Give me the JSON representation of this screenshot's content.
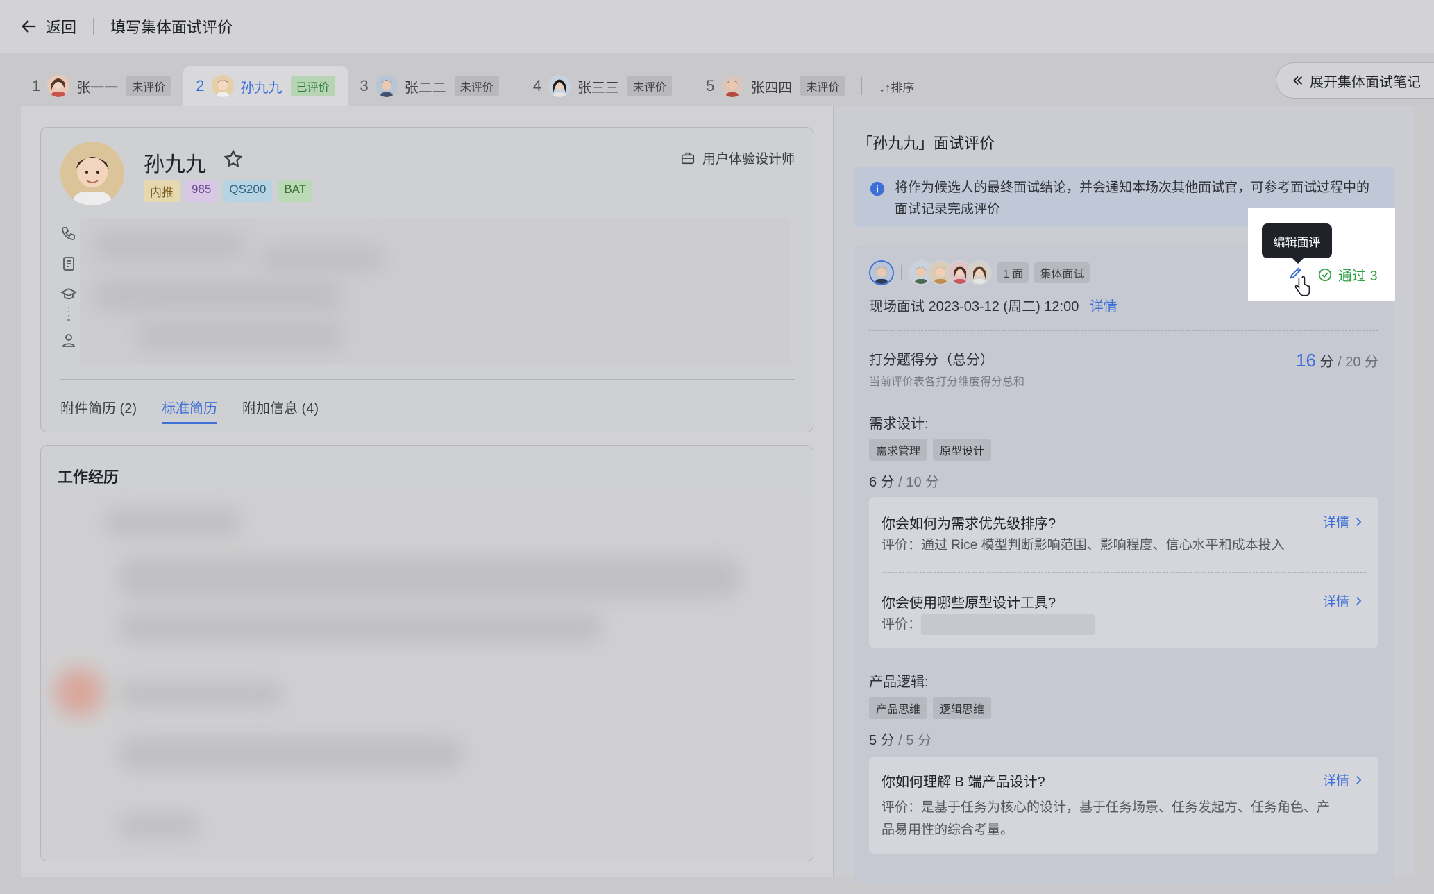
{
  "header": {
    "back_label": "返回",
    "title": "填写集体面试评价"
  },
  "candidates": [
    {
      "index": "1",
      "name": "张一一",
      "status": "未评价"
    },
    {
      "index": "2",
      "name": "孙九九",
      "status": "已评价"
    },
    {
      "index": "3",
      "name": "张二二",
      "status": "未评价"
    },
    {
      "index": "4",
      "name": "张三三",
      "status": "未评价"
    },
    {
      "index": "5",
      "name": "张四四",
      "status": "未评价"
    }
  ],
  "sort_label": "↓↑排序",
  "notes_button": "展开集体面试笔记",
  "profile": {
    "name": "孙九九",
    "tags": [
      "内推",
      "985",
      "QS200",
      "BAT"
    ],
    "job": "用户体验设计师",
    "subtabs": [
      "附件简历 (2)",
      "标准简历",
      "附加信息 (4)"
    ],
    "work_title": "工作经历"
  },
  "evaluation": {
    "title": "「孙九九」面试评价",
    "notice": "将作为候选人的最终面试结论，并会通知本场次其他面试官，可参考面试过程中的面试记录完成评价",
    "tooltip": "编辑面评",
    "result": "通过 3",
    "round": "1 面",
    "type": "集体面试",
    "meeting": "现场面试 2023-03-12 (周二) 12:00",
    "meeting_detail": "详情",
    "score_label": "打分题得分（总分）",
    "score_hint": "当前评价表各打分维度得分总和",
    "score": "16",
    "score_unit": "分",
    "score_total": "/ 20 分",
    "sections": [
      {
        "label": "需求设计:",
        "tags": [
          "需求管理",
          "原型设计"
        ],
        "score": "6 分",
        "total": "/ 10 分",
        "questions": [
          {
            "q": "你会如何为需求优先级排序?",
            "eval": "评价：通过 Rice 模型判断影响范围、影响程度、信心水平和成本投入",
            "detail": "详情"
          },
          {
            "q": "你会使用哪些原型设计工具?",
            "eval": "评价：",
            "detail": "详情"
          }
        ]
      },
      {
        "label": "产品逻辑:",
        "tags": [
          "产品思维",
          "逻辑思维"
        ],
        "score": "5 分",
        "total": "/ 5 分",
        "questions": [
          {
            "q": "你如何理解 B 端产品设计?",
            "eval1": "评价：是基于任务为核心的设计，基于任务场景、任务发起方、任务角色、产",
            "eval2": "品易用性的综合考量。",
            "detail": "详情"
          }
        ]
      }
    ]
  },
  "colors": {
    "accent": "#3c6fd8",
    "pass": "#2ea043",
    "tag_referral": "#e6d9b0",
    "tag_985": "#d8c8e6",
    "tag_qs": "#b8d4e2",
    "tag_bat": "#b9d9b7"
  }
}
